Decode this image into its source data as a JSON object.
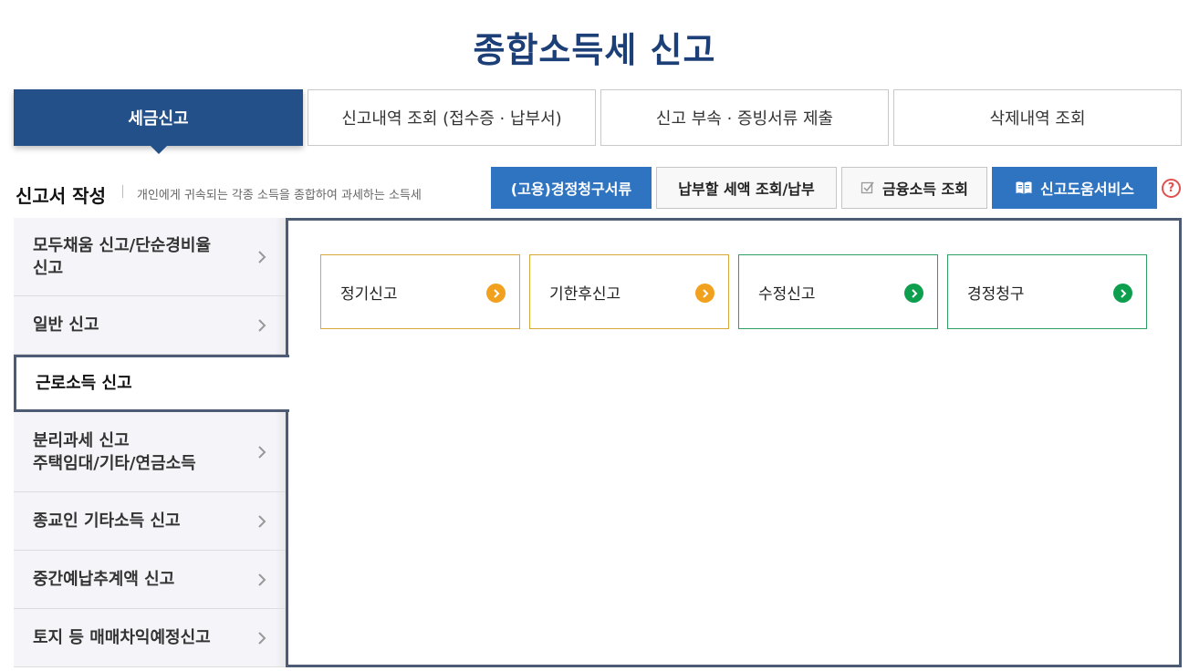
{
  "page": {
    "title": "종합소득세 신고"
  },
  "main_tabs": [
    {
      "label": "세금신고",
      "active": true
    },
    {
      "label": "신고내역 조회 (접수증 · 납부서)",
      "active": false
    },
    {
      "label": "신고 부속 · 증빙서류 제출",
      "active": false
    },
    {
      "label": "삭제내역 조회",
      "active": false
    }
  ],
  "section": {
    "title": "신고서 작성",
    "description": "개인에게 귀속되는 각종 소득을 종합하여 과세하는 소득세"
  },
  "actions": [
    {
      "label": "(고용)경정청구서류",
      "style": "blue",
      "icon": ""
    },
    {
      "label": "납부할 세액 조회/납부",
      "style": "gray",
      "icon": ""
    },
    {
      "label": "금융소득 조회",
      "style": "gray",
      "icon": "checkbox-icon"
    },
    {
      "label": "신고도움서비스",
      "style": "blue",
      "icon": "book-icon"
    }
  ],
  "help": {
    "label": "?"
  },
  "left_menu": [
    {
      "label": "모두채움 신고/단순경비율\n신고",
      "active": false
    },
    {
      "label": "일반 신고",
      "active": false
    },
    {
      "label": "근로소득 신고",
      "active": true
    },
    {
      "label": "분리과세 신고\n주택임대/기타/연금소득",
      "active": false
    },
    {
      "label": "종교인 기타소득 신고",
      "active": false
    },
    {
      "label": "중간예납추계액 신고",
      "active": false
    },
    {
      "label": "토지 등 매매차익예정신고",
      "active": false
    }
  ],
  "report_cards": [
    {
      "label": "정기신고",
      "color": "orange"
    },
    {
      "label": "기한후신고",
      "color": "orange"
    },
    {
      "label": "수정신고",
      "color": "green"
    },
    {
      "label": "경정청구",
      "color": "green"
    }
  ],
  "colors": {
    "title": "#1c3f78",
    "active_tab": "#24508a",
    "blue_button": "#2f74c0",
    "panel_border": "#4d5b74",
    "orange_accent": "#f2a11f",
    "green_accent": "#0d9e4e",
    "help": "#e0504f"
  }
}
